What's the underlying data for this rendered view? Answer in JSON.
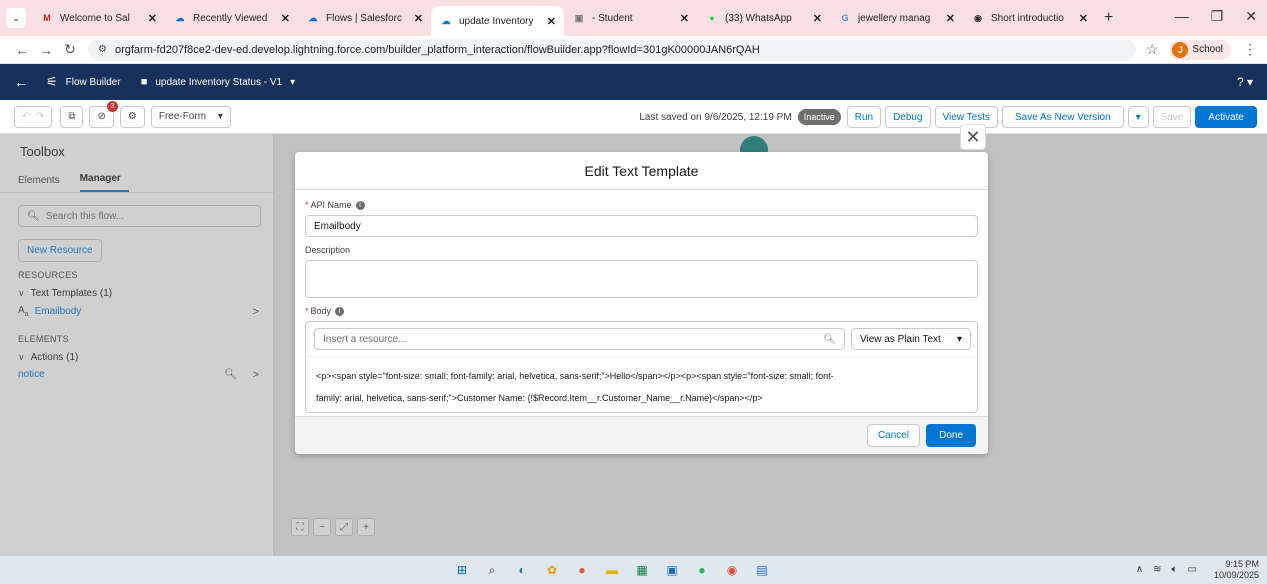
{
  "browser": {
    "tabs": [
      {
        "label": "Welcome to Sal",
        "favicon": "M",
        "color": "#c5221f"
      },
      {
        "label": "Recently Viewed",
        "favicon": "☁",
        "color": "#0176d3"
      },
      {
        "label": "Flows | Salesforc",
        "favicon": "☁",
        "color": "#0176d3"
      },
      {
        "label": "update Inventory",
        "favicon": "☁",
        "color": "#0176d3",
        "active": true
      },
      {
        "label": "- Student",
        "favicon": "▣",
        "color": "#777"
      },
      {
        "label": "(33) WhatsApp",
        "favicon": "●",
        "color": "#25d366"
      },
      {
        "label": "jewellery manag",
        "favicon": "G",
        "color": "#4285f4"
      },
      {
        "label": "Short introductio",
        "favicon": "◉",
        "color": "#333"
      }
    ],
    "url": "orgfarm-fd207f8ce2-dev-ed.develop.lightning.force.com/builder_platform_interaction/flowBuilder.app?flowId=301gK00000JAN6rQAH",
    "profile_initial": "J",
    "profile_label": "School"
  },
  "header": {
    "app_name": "Flow Builder",
    "flow_title": "update Inventory Status - V1",
    "help": "?"
  },
  "toolbar": {
    "error_count": "3",
    "layout_mode": "Free-Form",
    "last_saved": "Last saved on 9/6/2025, 12:19 PM",
    "status": "Inactive",
    "run": "Run",
    "debug": "Debug",
    "view_tests": "View Tests",
    "save_new_version": "Save As New Version",
    "save": "Save",
    "activate": "Activate"
  },
  "toolbox": {
    "title": "Toolbox",
    "tab_elements": "Elements",
    "tab_manager": "Manager",
    "search_placeholder": "Search this flow...",
    "new_resource": "New Resource",
    "resources_header": "RESOURCES",
    "text_templates_group": "Text Templates (1)",
    "text_template_item": "Emailbody",
    "elements_header": "ELEMENTS",
    "actions_group": "Actions (1)",
    "action_item": "notice"
  },
  "modal": {
    "title": "Edit Text Template",
    "api_name_label": "API Name",
    "api_name_value": "Emailbody",
    "description_label": "Description",
    "body_label": "Body",
    "resource_placeholder": "Insert a resource...",
    "view_mode": "View as Plain Text",
    "body_line1": "<p><span style=\"font-size: small; font-family: arial, helvetica, sans-serif;\">Hello</span></p><p><span style=\"font-size: small; font-",
    "body_line2": "family: arial, helvetica, sans-serif;\">Customer Name: {!$Record.Item__r.Customer_Name__r.Name}</span></p>",
    "cancel": "Cancel",
    "done": "Done"
  },
  "taskbar": {
    "time": "9:15 PM",
    "date": "10/09/2025"
  }
}
